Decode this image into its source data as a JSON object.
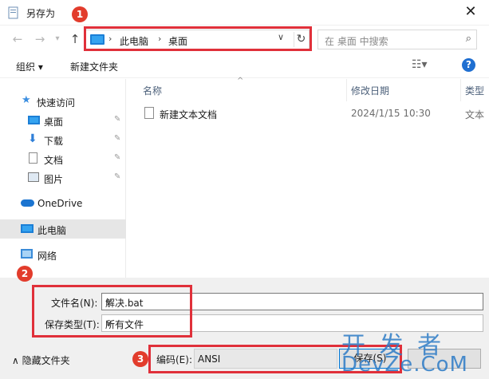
{
  "window": {
    "title": "另存为",
    "close_label": "✕"
  },
  "address": {
    "segments": [
      "此电脑",
      "桌面"
    ],
    "separator": "›"
  },
  "search": {
    "placeholder": "在 桌面 中搜索"
  },
  "toolbar": {
    "organize": "组织 ▾",
    "new_folder": "新建文件夹",
    "help": "?"
  },
  "sidebar": {
    "items": [
      {
        "label": "快速访问",
        "icon": "star-icon",
        "pinned": false
      },
      {
        "label": "桌面",
        "icon": "desktop-icon",
        "pinned": true
      },
      {
        "label": "下载",
        "icon": "download-icon",
        "pinned": true
      },
      {
        "label": "文档",
        "icon": "document-icon",
        "pinned": true
      },
      {
        "label": "图片",
        "icon": "picture-icon",
        "pinned": true
      },
      {
        "label": "OneDrive",
        "icon": "cloud-icon",
        "pinned": false
      },
      {
        "label": "此电脑",
        "icon": "pc-icon",
        "pinned": false,
        "selected": true
      },
      {
        "label": "网络",
        "icon": "network-icon",
        "pinned": false
      }
    ]
  },
  "filelist": {
    "columns": [
      "名称",
      "修改日期",
      "类型"
    ],
    "rows": [
      {
        "name": "新建文本文档",
        "date": "2024/1/15 10:30",
        "type": "文本"
      }
    ]
  },
  "form": {
    "filename_label": "文件名(N):",
    "filename_value": "解决.bat",
    "filetype_label": "保存类型(T):",
    "filetype_value": "所有文件"
  },
  "footer": {
    "hide_folders": "隐藏文件夹",
    "encoding_label": "编码(E):",
    "encoding_value": "ANSI",
    "save_label": "保存(S)"
  },
  "annotations": {
    "badge1": "1",
    "badge2": "2",
    "badge3": "3",
    "highlight_color": "#e0303a"
  },
  "watermark": {
    "line1": "开 发 者",
    "line2": "DevZe.CoM"
  }
}
